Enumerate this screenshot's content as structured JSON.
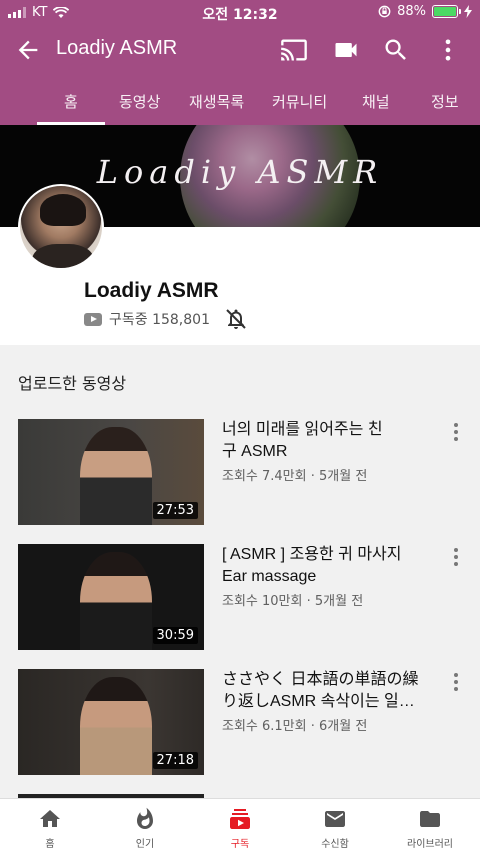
{
  "status_bar": {
    "carrier": "KT",
    "time": "오전 12:32",
    "battery": "88%",
    "battery_level": 0.88
  },
  "app_bar": {
    "title": "Loadiy ASMR",
    "icons": [
      "back-arrow-icon",
      "cast-icon",
      "camera-icon",
      "search-icon",
      "more-vert-icon"
    ]
  },
  "tabs": [
    {
      "label": "홈",
      "active": true
    },
    {
      "label": "동영상"
    },
    {
      "label": "재생목록"
    },
    {
      "label": "커뮤니티"
    },
    {
      "label": "채널"
    },
    {
      "label": "정보"
    }
  ],
  "banner": {
    "text": "Loadiy ASMR"
  },
  "channel": {
    "name": "Loadiy ASMR",
    "subscription_text": "구독중 158,801"
  },
  "section": {
    "title": "업로드한 동영상"
  },
  "videos": [
    {
      "title": "너의 미래를 읽어주는 친구 ASMR",
      "title_line1": "너의 미래를 읽어주는 친",
      "title_line2": "구 ASMR",
      "meta": "조회수 7.4만회 · 5개월 전",
      "duration": "27:53"
    },
    {
      "title": "[ ASMR ] 조용한 귀 마사지 Ear massage",
      "title_line1": "[ ASMR ] 조용한 귀 마사지",
      "title_line2": "Ear massage",
      "meta": "조회수 10만회 · 5개월 전",
      "duration": "30:59"
    },
    {
      "title": "ささやく 日本語の単語の繰り返しASMR 속삭이는 일…",
      "title_line1": "ささやく 日本語の単語の繰",
      "title_line2": "り返しASMR 속삭이는 일…",
      "meta": "조회수 6.1만회 · 6개월 전",
      "duration": "27:18"
    }
  ],
  "bottom_nav": [
    {
      "label": "홈",
      "icon": "home-icon"
    },
    {
      "label": "인기",
      "icon": "trending-icon"
    },
    {
      "label": "구독",
      "icon": "subscriptions-icon",
      "active": true
    },
    {
      "label": "수신함",
      "icon": "inbox-icon"
    },
    {
      "label": "라이브러리",
      "icon": "library-icon"
    }
  ],
  "colors": {
    "header": "#a24c83",
    "active_nav": "#e51b23",
    "battery": "#4cd964"
  }
}
